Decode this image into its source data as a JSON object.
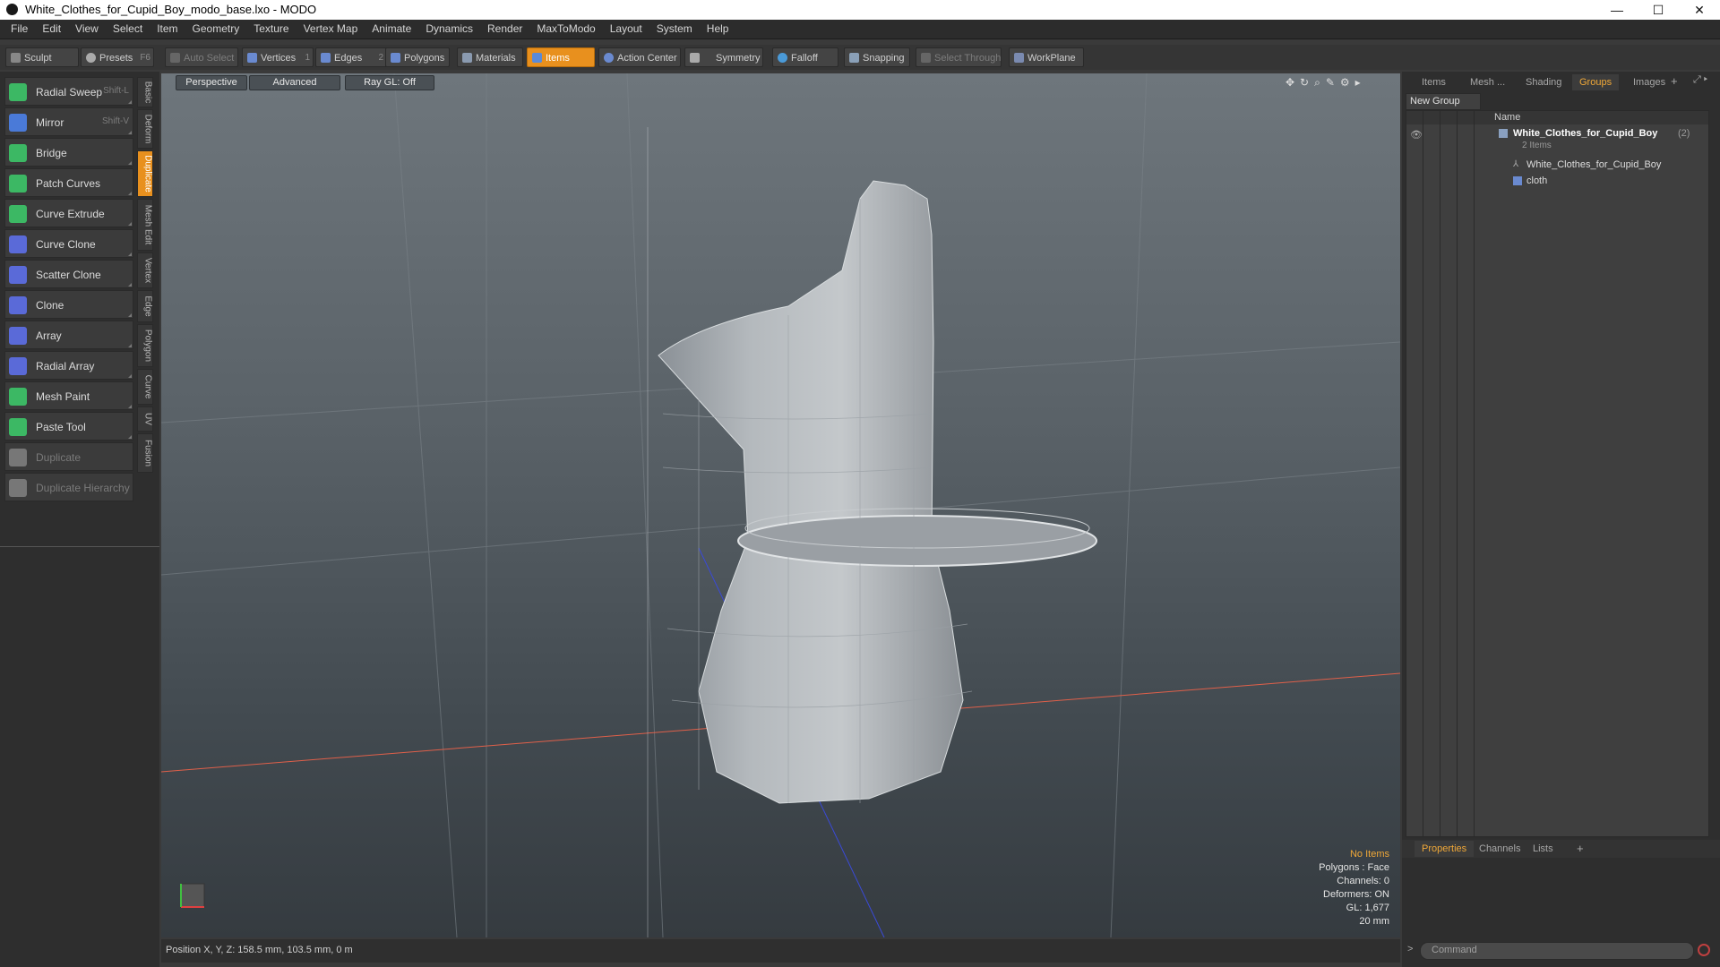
{
  "window": {
    "title": "White_Clothes_for_Cupid_Boy_modo_base.lxo - MODO",
    "minimize": "—",
    "maximize": "☐",
    "close": "✕"
  },
  "menu": [
    "File",
    "Edit",
    "View",
    "Select",
    "Item",
    "Geometry",
    "Texture",
    "Vertex Map",
    "Animate",
    "Dynamics",
    "Render",
    "MaxToModo",
    "Layout",
    "System",
    "Help"
  ],
  "toolbar": {
    "sculpt": "Sculpt",
    "presets": "Presets",
    "presets_key": "F6",
    "auto_select": "Auto Select",
    "vertices": "Vertices",
    "vertices_num": "1",
    "edges": "Edges",
    "edges_num": "2",
    "polygons": "Polygons",
    "materials": "Materials",
    "items": "Items",
    "action_center": "Action Center",
    "symmetry": "Symmetry",
    "falloff": "Falloff",
    "snapping": "Snapping",
    "select_through": "Select Through",
    "workplane": "WorkPlane"
  },
  "tools": [
    {
      "label": "Radial Sweep",
      "shortcut": "Shift-L",
      "color": "#3cb864"
    },
    {
      "label": "Mirror",
      "shortcut": "Shift-V",
      "color": "#4a7ad8"
    },
    {
      "label": "Bridge",
      "shortcut": "",
      "color": "#3cb864"
    },
    {
      "label": "Patch Curves",
      "shortcut": "",
      "color": "#3cb864"
    },
    {
      "label": "Curve Extrude",
      "shortcut": "",
      "color": "#3cb864"
    },
    {
      "label": "Curve Clone",
      "shortcut": "",
      "color": "#5a6ad8"
    },
    {
      "label": "Scatter Clone",
      "shortcut": "",
      "color": "#5a6ad8"
    },
    {
      "label": "Clone",
      "shortcut": "",
      "color": "#5a6ad8"
    },
    {
      "label": "Array",
      "shortcut": "",
      "color": "#5a6ad8"
    },
    {
      "label": "Radial Array",
      "shortcut": "",
      "color": "#5a6ad8"
    },
    {
      "label": "Mesh Paint",
      "shortcut": "",
      "color": "#3cb864"
    },
    {
      "label": "Paste Tool",
      "shortcut": "",
      "color": "#3cb864"
    },
    {
      "label": "Duplicate",
      "shortcut": "",
      "color": "#777777",
      "disabled": true
    },
    {
      "label": "Duplicate Hierarchy",
      "shortcut": "",
      "color": "#777777",
      "disabled": true
    }
  ],
  "side_tabs": [
    "Basic",
    "Deform",
    "Duplicate",
    "Mesh Edit",
    "Vertex",
    "Edge",
    "Polygon",
    "Curve",
    "UV",
    "Fusion"
  ],
  "viewport": {
    "view_mode": "Perspective",
    "shading": "Advanced",
    "raygl": "Ray GL: Off",
    "info": {
      "items": "No Items",
      "polygons": "Polygons : Face",
      "channels": "Channels: 0",
      "deformers": "Deformers: ON",
      "gl": "GL: 1,677",
      "scale": "20 mm"
    }
  },
  "status": {
    "position": "Position X, Y, Z:   158.5 mm, 103.5 mm, 0 m"
  },
  "right_tabs": [
    "Items",
    "Mesh ...",
    "Shading",
    "Groups",
    "Images"
  ],
  "groups": {
    "new_group": "New Group",
    "column_name": "Name",
    "root": {
      "name": "White_Clothes_for_Cupid_Boy",
      "count": "(2)",
      "sub": "2 Items"
    },
    "children": [
      "White_Clothes_for_Cupid_Boy",
      "cloth"
    ]
  },
  "bottom_tabs": [
    "Properties",
    "Channels",
    "Lists"
  ],
  "command": {
    "placeholder": "Command"
  },
  "colors": {
    "accent": "#e8901e",
    "selected_text": "#f0a838"
  }
}
